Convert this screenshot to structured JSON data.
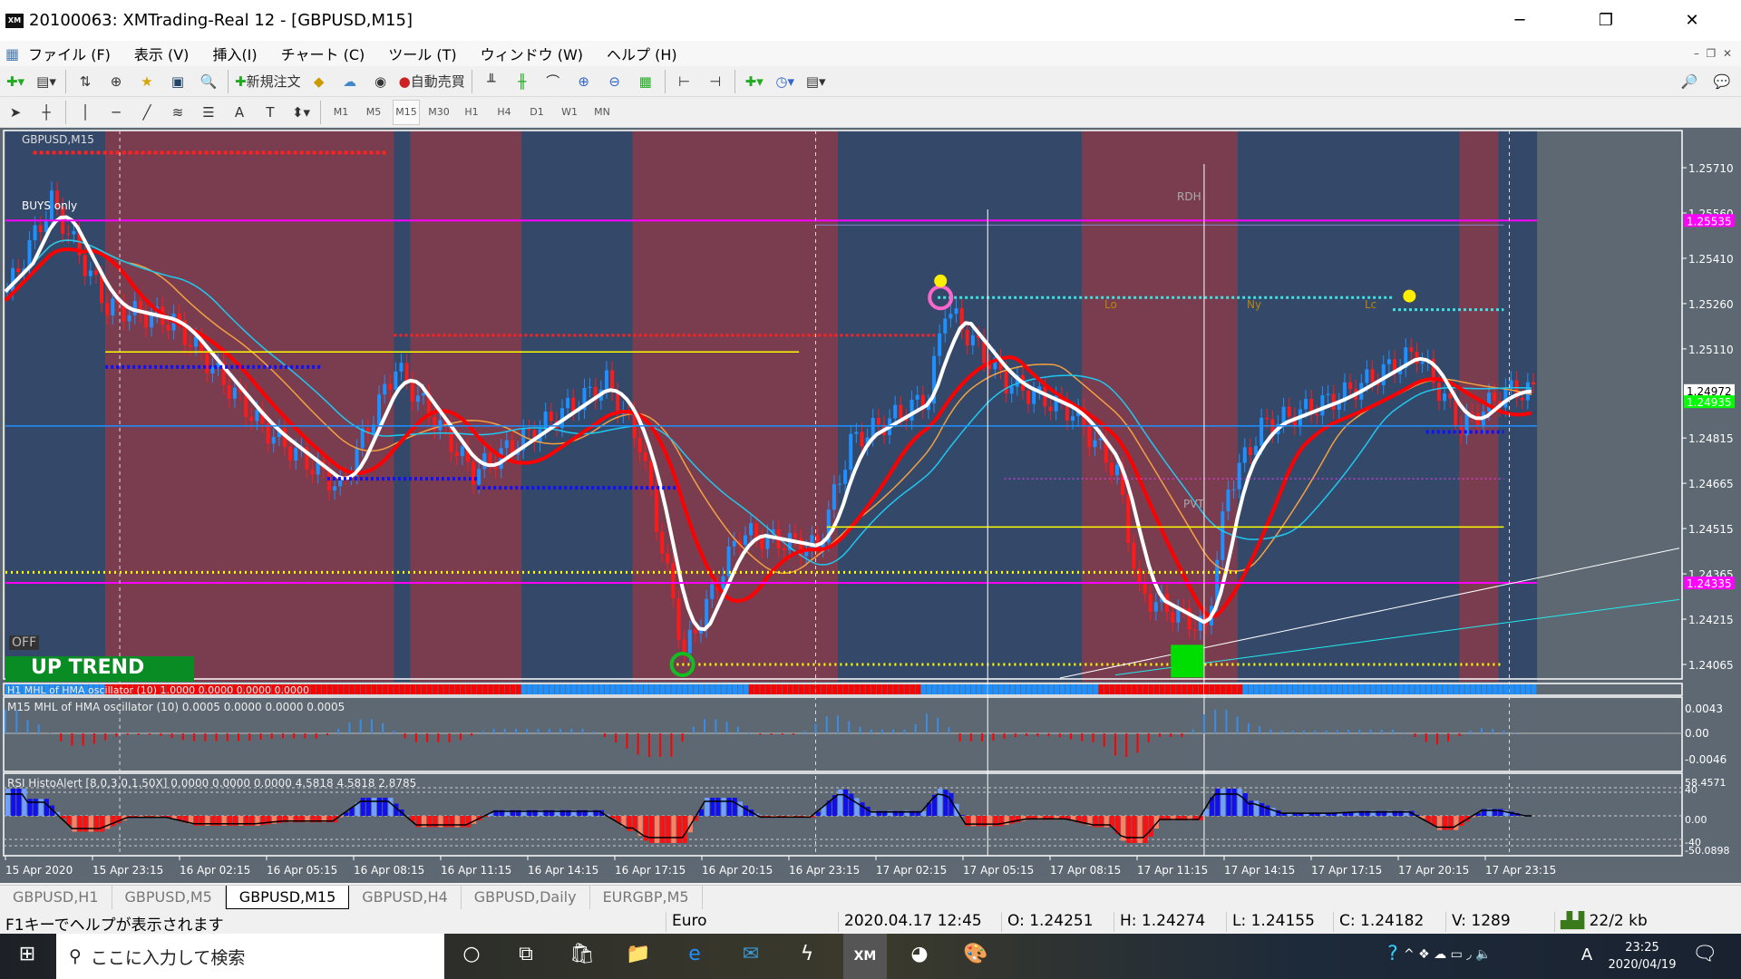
{
  "window": {
    "title": "20100063: XMTrading-Real 12 - [GBPUSD,M15]",
    "logo": "XM"
  },
  "menu": [
    "ファイル (F)",
    "表示 (V)",
    "挿入(I)",
    "チャート (C)",
    "ツール (T)",
    "ウィンドウ (W)",
    "ヘルプ (H)"
  ],
  "toolbar": {
    "new_order": "新規注文",
    "auto_trade": "自動売買",
    "timeframes": [
      "M1",
      "M5",
      "M15",
      "M30",
      "H1",
      "H4",
      "D1",
      "W1",
      "MN"
    ],
    "active_tf": "M15"
  },
  "chart": {
    "symbol_label": "GBPUSD,M15",
    "buys_only": "BUYS only",
    "trend_label": "UP TREND",
    "off_label": "OFF",
    "rdh": "RDH",
    "pvt": "PVT",
    "session_labels": [
      "Lo",
      "Ny",
      "Lc"
    ],
    "price_ticks": [
      "1.25710",
      "1.25560",
      "1.25410",
      "1.25260",
      "1.25110",
      "1.24815",
      "1.24665",
      "1.24515",
      "1.24365",
      "1.24215",
      "1.24065"
    ],
    "price_tick_values": [
      1.2571,
      1.2556,
      1.2541,
      1.2526,
      1.2511,
      1.24815,
      1.24665,
      1.24515,
      1.24365,
      1.24215,
      1.24065
    ],
    "price_tags": [
      {
        "text": "1.25535",
        "value": 1.25535,
        "color": "#ff00ff"
      },
      {
        "text": "1.24972",
        "value": 1.24972,
        "color": "#ffffff"
      },
      {
        "text": "1.24935",
        "value": 1.24935,
        "color": "#00ff00"
      },
      {
        "text": "1.24335",
        "value": 1.24335,
        "color": "#ff00ff"
      }
    ],
    "price_path": [
      [
        0,
        1.253
      ],
      [
        8,
        1.256
      ],
      [
        18,
        1.2525
      ],
      [
        30,
        1.252
      ],
      [
        46,
        1.2485
      ],
      [
        60,
        1.2465
      ],
      [
        70,
        1.2505
      ],
      [
        84,
        1.247
      ],
      [
        92,
        1.248
      ],
      [
        108,
        1.25
      ],
      [
        114,
        1.248
      ],
      [
        122,
        1.241
      ],
      [
        132,
        1.245
      ],
      [
        146,
        1.2445
      ],
      [
        152,
        1.248
      ],
      [
        166,
        1.2495
      ],
      [
        169,
        1.2525
      ],
      [
        180,
        1.25
      ],
      [
        192,
        1.249
      ],
      [
        200,
        1.247
      ],
      [
        204,
        1.243
      ],
      [
        216,
        1.2418
      ],
      [
        220,
        1.2465
      ],
      [
        226,
        1.2485
      ],
      [
        240,
        1.2495
      ],
      [
        254,
        1.251
      ],
      [
        262,
        1.2485
      ],
      [
        270,
        1.2497
      ]
    ],
    "osc1_label": "H1 MHL of HMA oscillator (10) 1.0000 0.0000 0.0000 0.0000",
    "osc2_label": "M15 MHL of HMA oscillator (10) 0.0005 0.0000 0.0000 0.0005",
    "osc2_ticks": [
      "0.0043",
      "0.00",
      "-0.0046"
    ],
    "rsi_label": "RSI HistoAlert [8,0,3,0,1.50X] 0.0000 0.0000 0.0000 4.5818 4.5818 2.8785",
    "rsi_ticks": [
      "58.4571",
      "40",
      "0.00",
      "-40",
      "-50.0898"
    ],
    "time_labels": [
      "15 Apr 2020",
      "15 Apr 23:15",
      "16 Apr 02:15",
      "16 Apr 05:15",
      "16 Apr 08:15",
      "16 Apr 11:15",
      "16 Apr 14:15",
      "16 Apr 17:15",
      "16 Apr 20:15",
      "16 Apr 23:15",
      "17 Apr 02:15",
      "17 Apr 05:15",
      "17 Apr 08:15",
      "17 Apr 11:15",
      "17 Apr 14:15",
      "17 Apr 17:15",
      "17 Apr 20:15",
      "17 Apr 23:15"
    ]
  },
  "tabs": [
    "GBPUSD,H1",
    "GBPUSD,M5",
    "GBPUSD,M15",
    "GBPUSD,H4",
    "GBPUSD,Daily",
    "EURGBP,M5"
  ],
  "active_tab": 2,
  "status": {
    "help": "F1キーでヘルプが表示されます",
    "profile": "Euro",
    "datetime": "2020.04.17 12:45",
    "open": "O: 1.24251",
    "high": "H: 1.24274",
    "low": "L: 1.24155",
    "close": "C: 1.24182",
    "volume": "V: 1289",
    "traffic": "22/2 kb"
  },
  "taskbar": {
    "search_placeholder": "ここに入力して検索",
    "time": "23:25",
    "date": "2020/04/19",
    "ime": "A"
  }
}
